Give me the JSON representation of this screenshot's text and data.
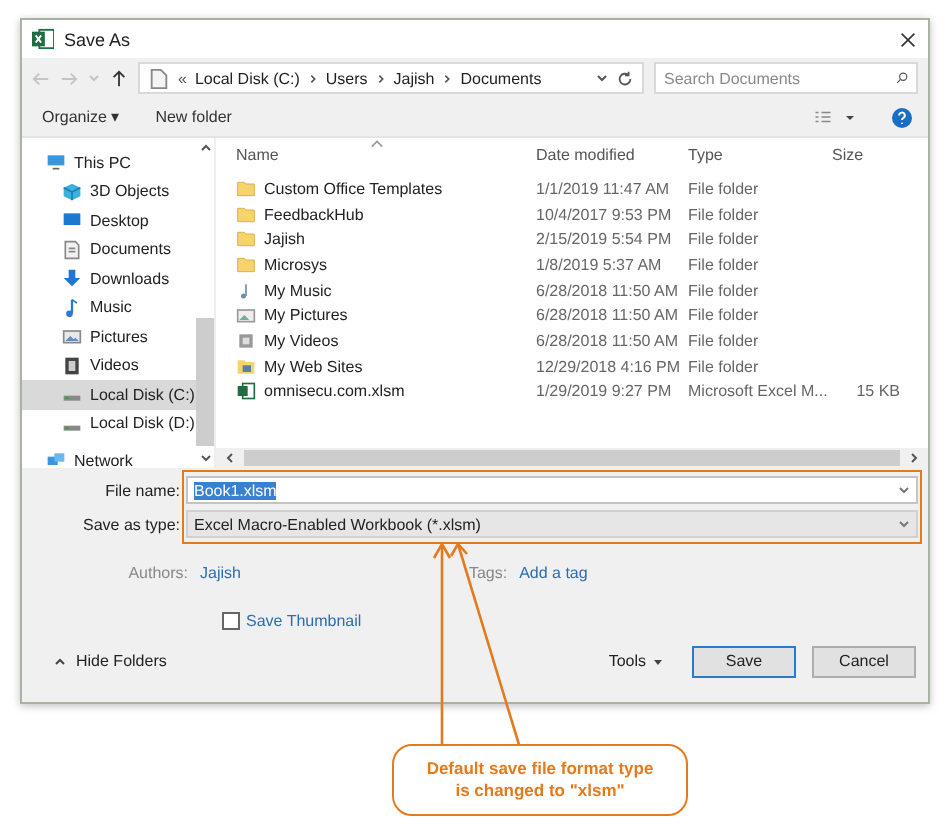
{
  "window": {
    "title": "Save As"
  },
  "nav_buttons": [
    {
      "kind": "back",
      "disabled": true
    },
    {
      "kind": "forward",
      "disabled": true
    },
    {
      "kind": "recent",
      "disabled": true
    },
    {
      "kind": "up",
      "disabled": false
    }
  ],
  "breadcrumb": {
    "overflow": "«",
    "parts": [
      "Local Disk (C:)",
      "Users",
      "Jajish",
      "Documents"
    ]
  },
  "search": {
    "placeholder": "Search Documents"
  },
  "toolbar": {
    "organize": "Organize ▾",
    "new_folder": "New folder"
  },
  "sidebar": {
    "items": [
      {
        "label": "This PC",
        "kind": "pc",
        "selected": false,
        "children": [
          {
            "label": "3D Objects",
            "kind": "cube",
            "selected": false
          },
          {
            "label": "Desktop",
            "kind": "desktop",
            "selected": false
          },
          {
            "label": "Documents",
            "kind": "document",
            "selected": false
          },
          {
            "label": "Downloads",
            "kind": "download",
            "selected": false
          },
          {
            "label": "Music",
            "kind": "music",
            "selected": false
          },
          {
            "label": "Pictures",
            "kind": "pictures",
            "selected": false
          },
          {
            "label": "Videos",
            "kind": "videos",
            "selected": false
          },
          {
            "label": "Local Disk (C:)",
            "kind": "drive",
            "selected": true
          },
          {
            "label": "Local Disk (D:)",
            "kind": "drive",
            "selected": false
          }
        ]
      },
      {
        "label": "Network",
        "kind": "network",
        "selected": false
      }
    ]
  },
  "table": {
    "columns": [
      "Name",
      "Date modified",
      "Type",
      "Size"
    ],
    "rows": [
      {
        "name": "Custom Office Templates",
        "date": "1/1/2019 11:47 AM",
        "type": "File folder",
        "kind": "folder"
      },
      {
        "name": "FeedbackHub",
        "date": "10/4/2017 9:53 PM",
        "type": "File folder",
        "kind": "folder"
      },
      {
        "name": "Jajish",
        "date": "2/15/2019 5:54 PM",
        "type": "File folder",
        "kind": "folder"
      },
      {
        "name": "Microsys",
        "date": "1/8/2019 5:37 AM",
        "type": "File folder",
        "kind": "folder"
      },
      {
        "name": "My Music",
        "date": "6/28/2018 11:50 AM",
        "type": "File folder",
        "kind": "music"
      },
      {
        "name": "My Pictures",
        "date": "6/28/2018 11:50 AM",
        "type": "File folder",
        "kind": "pictures"
      },
      {
        "name": "My Videos",
        "date": "6/28/2018 11:50 AM",
        "type": "File folder",
        "kind": "videos"
      },
      {
        "name": "My Web Sites",
        "date": "12/29/2018 4:16 PM",
        "type": "File folder",
        "kind": "web"
      },
      {
        "name": "omnisecu.com.xlsm",
        "date": "1/29/2019 9:27 PM",
        "type": "Microsoft Excel M...",
        "size": "15 KB",
        "kind": "excel"
      }
    ]
  },
  "form": {
    "file_name_label": "File name:",
    "file_name": "Book1.xlsm",
    "file_name_highlighted": true,
    "type_label": "Save as type:",
    "save_as_type": "Excel Macro-Enabled Workbook (*.xlsm)",
    "authors_label": "Authors:",
    "authors": "Jajish",
    "tags_label": "Tags:",
    "tags": "Add a tag",
    "save_thumbnail": {
      "label": "Save Thumbnail",
      "checked": false
    }
  },
  "footer": {
    "hide_folders": "Hide Folders",
    "buttons": [
      {
        "label": "Tools",
        "kind": "menu",
        "default": false
      },
      {
        "label": "Save",
        "kind": "push",
        "default": true
      },
      {
        "label": "Cancel",
        "kind": "push",
        "default": false
      }
    ]
  },
  "annotation": {
    "text": "Default save file format type is changed to \"xlsm\""
  }
}
